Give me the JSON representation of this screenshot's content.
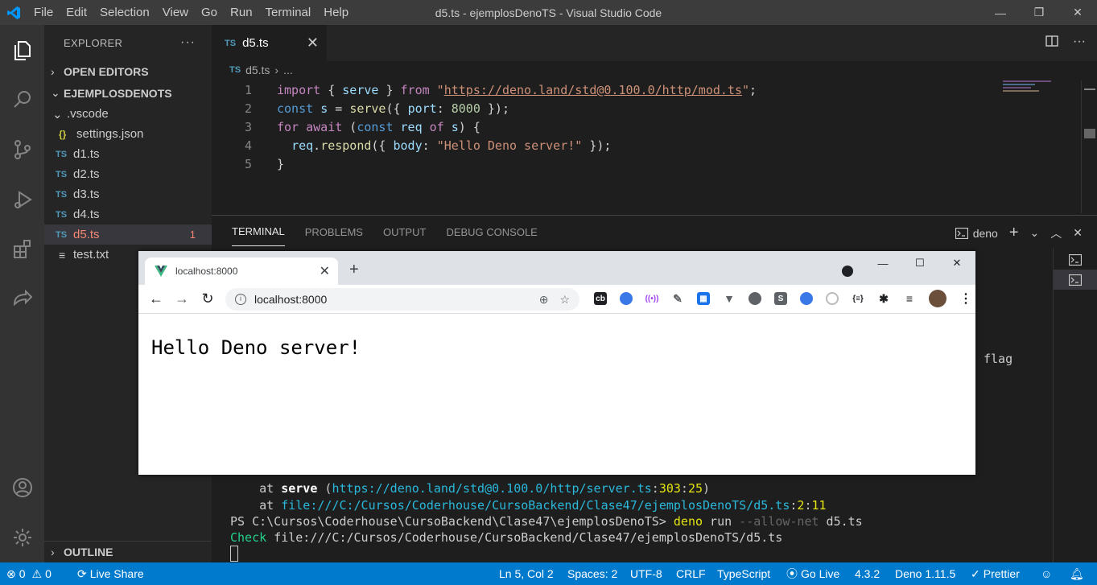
{
  "window": {
    "title": "d5.ts - ejemplosDenoTS - Visual Studio Code"
  },
  "menu": [
    "File",
    "Edit",
    "Selection",
    "View",
    "Go",
    "Run",
    "Terminal",
    "Help"
  ],
  "sidebar": {
    "header": "EXPLORER",
    "open_editors": "OPEN EDITORS",
    "project": "EJEMPLOSDENOTS",
    "folder": ".vscode",
    "files": [
      {
        "badge": "{}",
        "name": "settings.json"
      },
      {
        "badge": "TS",
        "name": "d1.ts"
      },
      {
        "badge": "TS",
        "name": "d2.ts"
      },
      {
        "badge": "TS",
        "name": "d3.ts"
      },
      {
        "badge": "TS",
        "name": "d4.ts"
      },
      {
        "badge": "TS",
        "name": "d5.ts",
        "count": "1"
      },
      {
        "badge": "≡",
        "name": "test.txt"
      }
    ],
    "outline": "OUTLINE"
  },
  "editor": {
    "tab_label": "d5.ts",
    "tab_badge": "TS",
    "breadcrumb_file": "d5.ts",
    "breadcrumb_sep": "›",
    "breadcrumb_more": "...",
    "line_numbers": [
      "1",
      "2",
      "3",
      "4",
      "5"
    ],
    "lines": [
      [
        {
          "t": "import",
          "c": "ctl"
        },
        {
          "t": " { ",
          "c": ""
        },
        {
          "t": "serve",
          "c": "var"
        },
        {
          "t": " } ",
          "c": ""
        },
        {
          "t": "from",
          "c": "ctl"
        },
        {
          "t": " \"",
          "c": "str"
        },
        {
          "t": "https://deno.land/std@0.100.0/http/mod.ts",
          "c": "url"
        },
        {
          "t": "\"",
          "c": "str"
        },
        {
          "t": ";",
          "c": ""
        }
      ],
      [
        {
          "t": "const",
          "c": "kw"
        },
        {
          "t": " ",
          "c": ""
        },
        {
          "t": "s",
          "c": "var"
        },
        {
          "t": " = ",
          "c": ""
        },
        {
          "t": "serve",
          "c": "fn"
        },
        {
          "t": "({ ",
          "c": ""
        },
        {
          "t": "port",
          "c": "var"
        },
        {
          "t": ": ",
          "c": ""
        },
        {
          "t": "8000",
          "c": "num"
        },
        {
          "t": " });",
          "c": ""
        }
      ],
      [
        {
          "t": "for",
          "c": "ctl"
        },
        {
          "t": " ",
          "c": ""
        },
        {
          "t": "await",
          "c": "ctl"
        },
        {
          "t": " (",
          "c": ""
        },
        {
          "t": "const",
          "c": "kw"
        },
        {
          "t": " ",
          "c": ""
        },
        {
          "t": "req",
          "c": "var"
        },
        {
          "t": " ",
          "c": ""
        },
        {
          "t": "of",
          "c": "ctl"
        },
        {
          "t": " ",
          "c": ""
        },
        {
          "t": "s",
          "c": "var"
        },
        {
          "t": ") {",
          "c": ""
        }
      ],
      [
        {
          "t": "  ",
          "c": ""
        },
        {
          "t": "req",
          "c": "var"
        },
        {
          "t": ".",
          "c": ""
        },
        {
          "t": "respond",
          "c": "fn"
        },
        {
          "t": "({ ",
          "c": ""
        },
        {
          "t": "body",
          "c": "var"
        },
        {
          "t": ": ",
          "c": ""
        },
        {
          "t": "\"Hello Deno server!\"",
          "c": "str"
        },
        {
          "t": " });",
          "c": ""
        }
      ],
      [
        {
          "t": "}",
          "c": ""
        }
      ]
    ]
  },
  "panel": {
    "tabs": [
      "TERMINAL",
      "PROBLEMS",
      "OUTPUT",
      "DEBUG CONSOLE"
    ],
    "shell": "deno",
    "terminal_lines": [
      [
        {
          "t": "    at ",
          "c": ""
        },
        {
          "t": "serve",
          "c": "tb"
        },
        {
          "t": " (",
          "c": ""
        },
        {
          "t": "https://deno.land/std@0.100.0/http/server.ts",
          "c": "tcyan"
        },
        {
          "t": ":",
          "c": ""
        },
        {
          "t": "303",
          "c": "tyel"
        },
        {
          "t": ":",
          "c": ""
        },
        {
          "t": "25",
          "c": "tyel"
        },
        {
          "t": ")",
          "c": ""
        }
      ],
      [
        {
          "t": "    at ",
          "c": ""
        },
        {
          "t": "file:///C:/Cursos/Coderhouse/CursoBackend/Clase47/ejemplosDenoTS/d5.ts",
          "c": "tcyan"
        },
        {
          "t": ":",
          "c": ""
        },
        {
          "t": "2",
          "c": "tyel"
        },
        {
          "t": ":",
          "c": ""
        },
        {
          "t": "11",
          "c": "tyel"
        }
      ],
      [
        {
          "t": "PS C:\\Cursos\\Coderhouse\\CursoBackend\\Clase47\\ejemplosDenoTS> ",
          "c": ""
        },
        {
          "t": "deno",
          "c": "tyel"
        },
        {
          "t": " run ",
          "c": ""
        },
        {
          "t": "--allow-net",
          "c": "tgry"
        },
        {
          "t": " d5.ts",
          "c": ""
        }
      ],
      [
        {
          "t": "Check",
          "c": "tgrn"
        },
        {
          "t": " file:///C:/Cursos/Coderhouse/CursoBackend/Clase47/ejemplosDenoTS/d5.ts",
          "c": ""
        }
      ]
    ],
    "flag_text": "flag"
  },
  "status": {
    "errors": "0",
    "warnings": "0",
    "live_share": "Live Share",
    "position": "Ln 5, Col 2",
    "spaces": "Spaces: 2",
    "encoding": "UTF-8",
    "eol": "CRLF",
    "language": "TypeScript",
    "go_live": "Go Live",
    "ts_version": "4.3.2",
    "deno": "Deno 1.11.5",
    "prettier": "Prettier"
  },
  "browser": {
    "tab_title": "localhost:8000",
    "address": "localhost:8000",
    "content": "Hello Deno server!"
  }
}
